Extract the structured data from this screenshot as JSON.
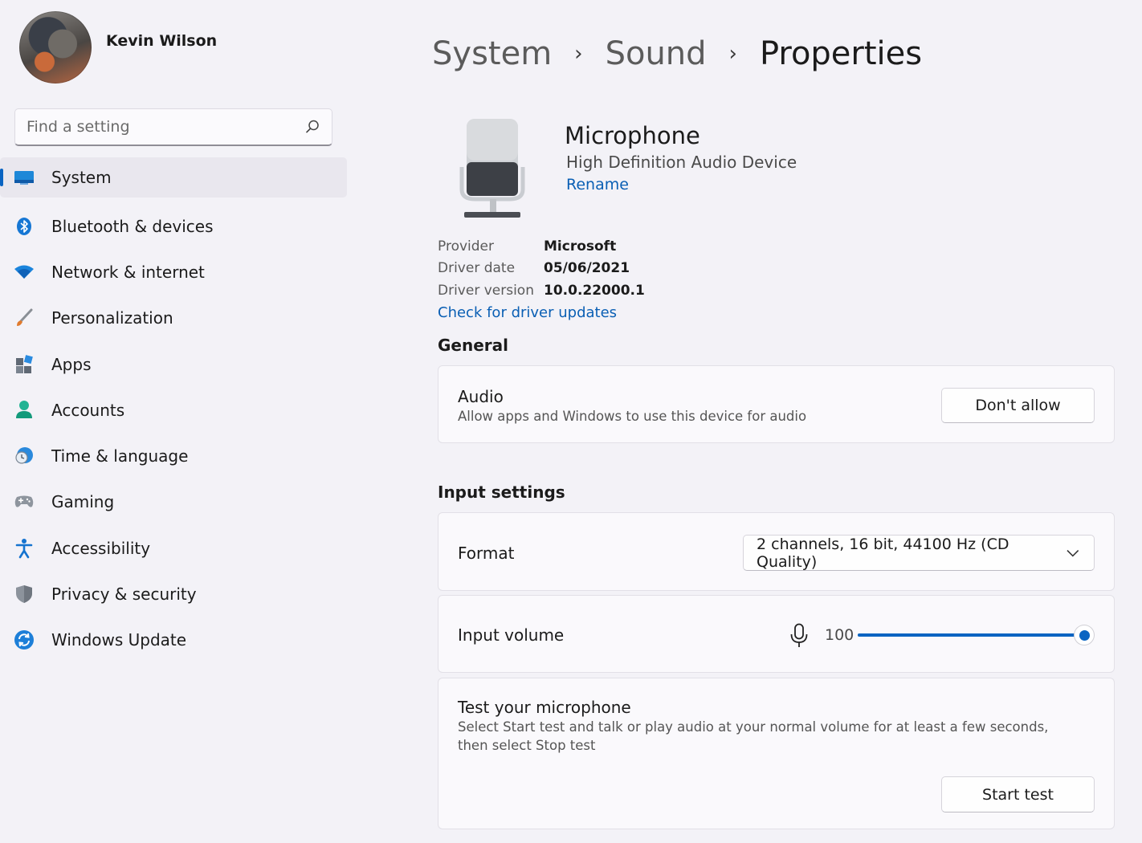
{
  "user": {
    "name": "Kevin Wilson"
  },
  "search": {
    "placeholder": "Find a setting"
  },
  "sidebar": {
    "items": [
      {
        "label": "System",
        "icon": "monitor-icon",
        "active": true
      },
      {
        "label": "Bluetooth & devices",
        "icon": "bluetooth-icon"
      },
      {
        "label": "Network & internet",
        "icon": "wifi-icon"
      },
      {
        "label": "Personalization",
        "icon": "brush-icon"
      },
      {
        "label": "Apps",
        "icon": "apps-icon"
      },
      {
        "label": "Accounts",
        "icon": "person-icon"
      },
      {
        "label": "Time & language",
        "icon": "clock-globe-icon"
      },
      {
        "label": "Gaming",
        "icon": "gamepad-icon"
      },
      {
        "label": "Accessibility",
        "icon": "accessibility-icon"
      },
      {
        "label": "Privacy & security",
        "icon": "shield-icon"
      },
      {
        "label": "Windows Update",
        "icon": "update-icon"
      }
    ]
  },
  "breadcrumb": {
    "items": [
      "System",
      "Sound",
      "Properties"
    ],
    "separator": "›"
  },
  "device": {
    "name": "Microphone",
    "subtitle": "High Definition Audio Device",
    "rename_label": "Rename"
  },
  "properties": {
    "rows": [
      {
        "key": "Provider",
        "value": "Microsoft"
      },
      {
        "key": "Driver date",
        "value": "05/06/2021"
      },
      {
        "key": "Driver version",
        "value": "10.0.22000.1"
      }
    ],
    "driver_link": "Check for driver updates"
  },
  "general": {
    "title": "General",
    "audio": {
      "title": "Audio",
      "description": "Allow apps and Windows to use this device for audio",
      "button_label": "Don't allow"
    }
  },
  "input_settings": {
    "title": "Input settings",
    "format": {
      "label": "Format",
      "selected": "2 channels, 16 bit, 44100 Hz (CD Quality)"
    },
    "volume": {
      "label": "Input volume",
      "value": "100",
      "fraction": 1.0
    },
    "test": {
      "title": "Test your microphone",
      "description": "Select Start test and talk or play audio at your normal volume for at least a few seconds, then select Stop test",
      "button_label": "Start test"
    }
  },
  "colors": {
    "accent": "#0a64c2",
    "link": "#0a5fb4",
    "background": "#f3f2f7",
    "card": "#faf9fc"
  }
}
